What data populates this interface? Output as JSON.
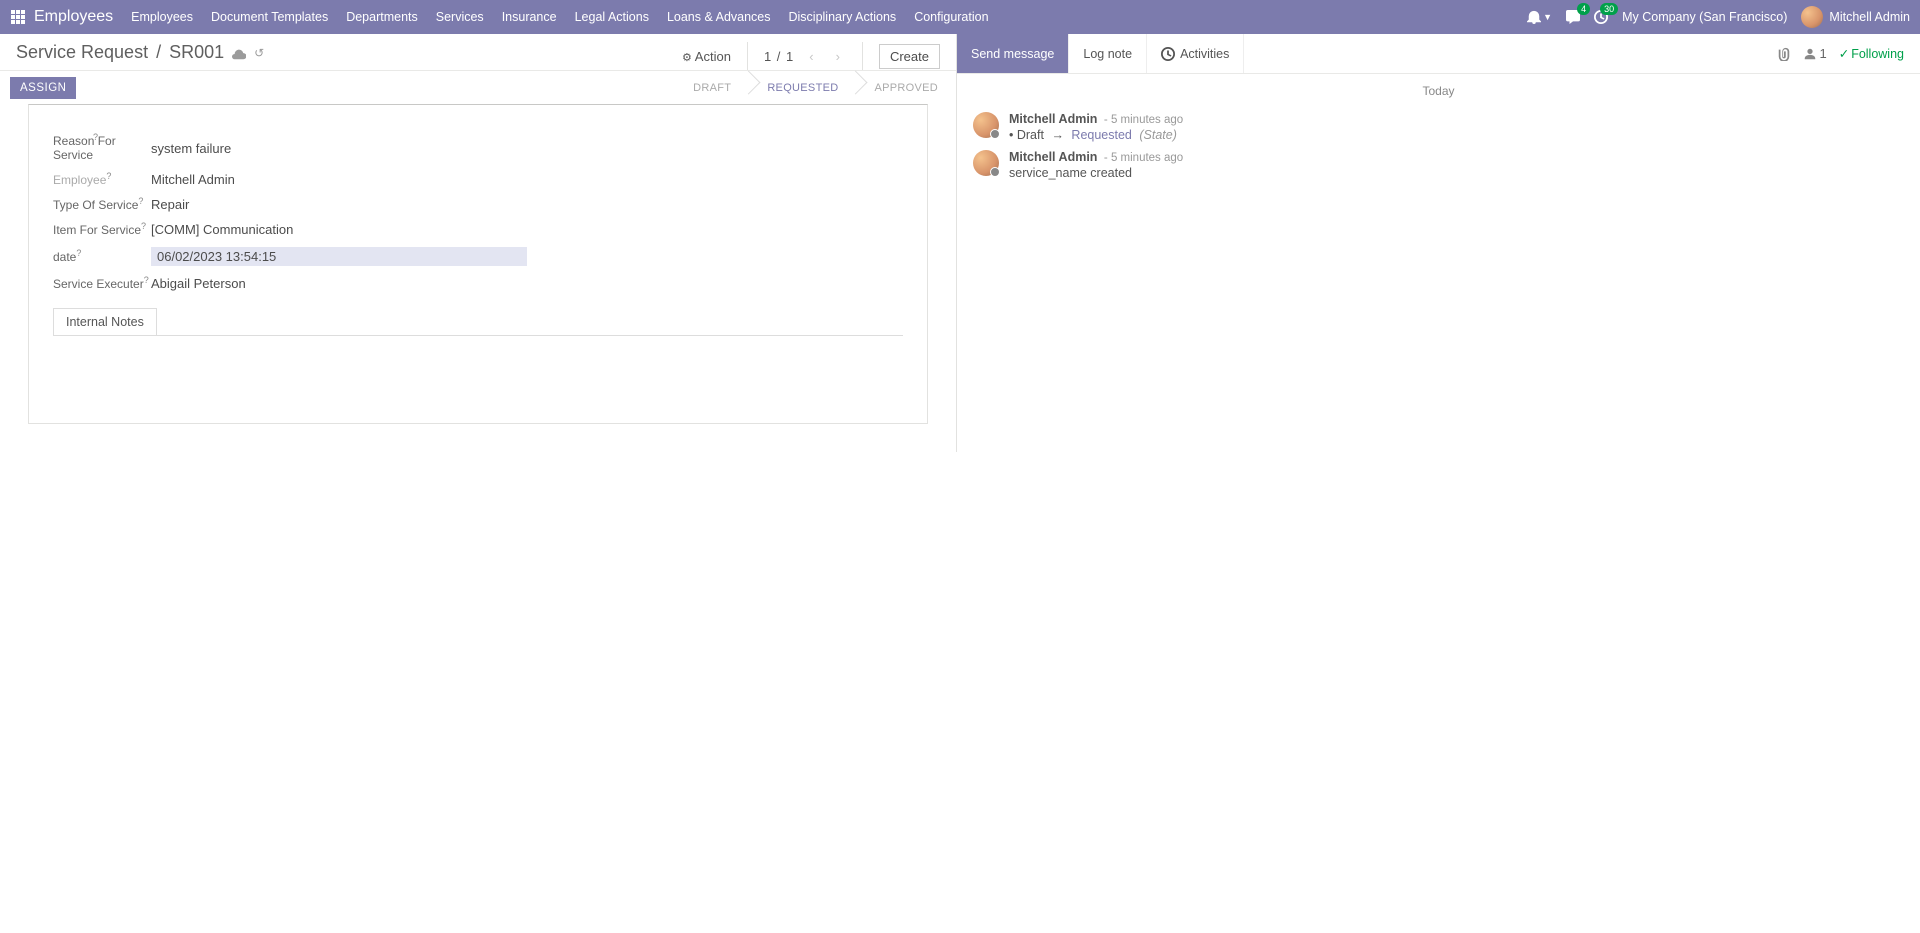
{
  "nav": {
    "brand": "Employees",
    "menu": [
      "Employees",
      "Document Templates",
      "Departments",
      "Services",
      "Insurance",
      "Legal Actions",
      "Loans & Advances",
      "Disciplinary Actions",
      "Configuration"
    ],
    "discuss_badge": "4",
    "activity_badge": "30",
    "company": "My Company (San Francisco)",
    "user": "Mitchell Admin"
  },
  "breadcrumb": {
    "path": "Service Request",
    "current": "SR001"
  },
  "action_label": "Action",
  "pager": {
    "pos": "1",
    "sep": "/",
    "total": "1"
  },
  "create_label": "Create",
  "stages": {
    "assign": "ASSIGN",
    "draft": "DRAFT",
    "requested": "REQUESTED",
    "approved": "APPROVED"
  },
  "form": {
    "fields": {
      "reason_label": "Reason For Service",
      "reason_value": "system failure",
      "employee_label": "Employee",
      "employee_value": "Mitchell Admin",
      "type_label": "Type Of Service",
      "type_value": "Repair",
      "item_label": "Item For Service",
      "item_value": "[COMM] Communication",
      "date_label": "date",
      "date_value": "06/02/2023 13:54:15",
      "executer_label": "Service Executer",
      "executer_value": "Abigail Peterson"
    },
    "tab": "Internal Notes"
  },
  "chatter": {
    "send_message": "Send message",
    "log_note": "Log note",
    "activities": "Activities",
    "follower_count": "1",
    "following": "Following",
    "today": "Today",
    "messages": [
      {
        "author": "Mitchell Admin",
        "time": "- 5 minutes ago",
        "type": "state_change",
        "from": "Draft",
        "to": "Requested",
        "field": "(State)"
      },
      {
        "author": "Mitchell Admin",
        "time": "- 5 minutes ago",
        "type": "text",
        "text": "service_name created"
      }
    ]
  }
}
